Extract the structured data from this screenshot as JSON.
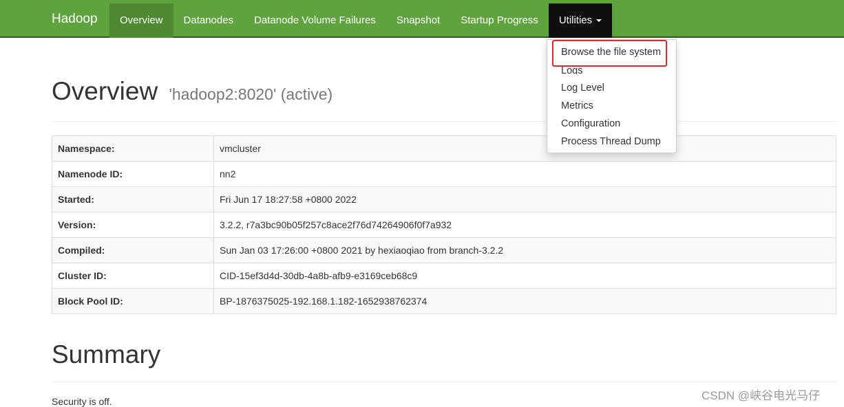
{
  "navbar": {
    "brand": "Hadoop",
    "items": [
      {
        "label": "Overview",
        "active": true
      },
      {
        "label": "Datanodes"
      },
      {
        "label": "Datanode Volume Failures"
      },
      {
        "label": "Snapshot"
      },
      {
        "label": "Startup Progress"
      },
      {
        "label": "Utilities",
        "open": true
      }
    ],
    "colors": {
      "background": "#5fa33e",
      "active": "#4e8a32",
      "open": "#0f0f0f",
      "highlight": "#e3262b"
    }
  },
  "utilities_menu": {
    "items": [
      {
        "label": "Browse the file system",
        "highlighted": true
      },
      {
        "label": "Logs"
      },
      {
        "label": "Log Level"
      },
      {
        "label": "Metrics"
      },
      {
        "label": "Configuration"
      },
      {
        "label": "Process Thread Dump"
      }
    ]
  },
  "overview": {
    "title": "Overview",
    "subtitle": "'hadoop2:8020' (active)",
    "rows": [
      {
        "label": "Namespace:",
        "value": "vmcluster"
      },
      {
        "label": "Namenode ID:",
        "value": "nn2"
      },
      {
        "label": "Started:",
        "value": "Fri Jun 17 18:27:58 +0800 2022"
      },
      {
        "label": "Version:",
        "value": "3.2.2, r7a3bc90b05f257c8ace2f76d74264906f0f7a932"
      },
      {
        "label": "Compiled:",
        "value": "Sun Jan 03 17:26:00 +0800 2021 by hexiaoqiao from branch-3.2.2"
      },
      {
        "label": "Cluster ID:",
        "value": "CID-15ef3d4d-30db-4a8b-afb9-e3169ceb68c9"
      },
      {
        "label": "Block Pool ID:",
        "value": "BP-1876375025-192.168.1.182-1652938762374"
      }
    ]
  },
  "summary": {
    "title": "Summary",
    "security": "Security is off."
  },
  "watermark": "CSDN @峡谷电光马仔"
}
